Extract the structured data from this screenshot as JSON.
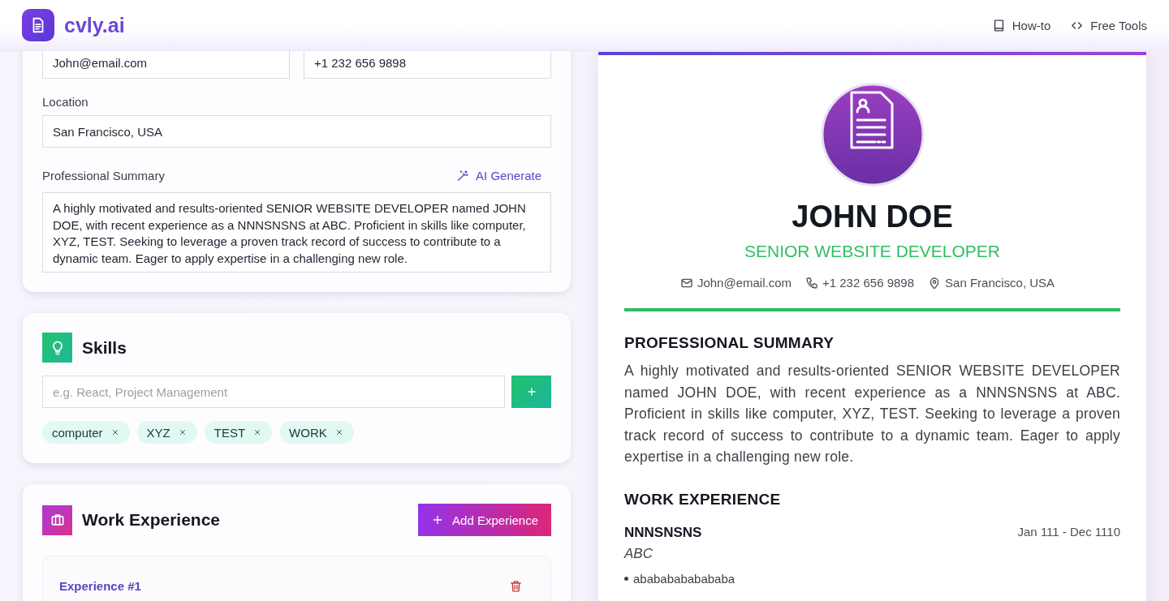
{
  "header": {
    "logo_text": "cvly.ai",
    "nav": [
      {
        "label": "How-to",
        "kind": "book"
      },
      {
        "label": "Free Tools",
        "kind": "code"
      }
    ]
  },
  "editor": {
    "email": "John@email.com",
    "phone": "+1 232 656 9898",
    "location_label": "Location",
    "location": "San Francisco, USA",
    "summary_label": "Professional Summary",
    "ai_button": "AI Generate",
    "summary": "A highly motivated and results-oriented SENIOR WEBSITE DEVELOPER named JOHN DOE, with recent experience as a NNNSNSNS at ABC. Proficient in skills like computer, XYZ, TEST. Seeking to leverage a proven track record of success to contribute to a dynamic team. Eager to apply expertise in a challenging new role."
  },
  "skills": {
    "title": "Skills",
    "placeholder": "e.g. React, Project Management",
    "tags": [
      {
        "label": "computer"
      },
      {
        "label": "XYZ"
      },
      {
        "label": "TEST"
      },
      {
        "label": "WORK"
      }
    ]
  },
  "work": {
    "title": "Work Experience",
    "add_button": "Add Experience",
    "entries": [
      {
        "label": "Experience #1"
      }
    ]
  },
  "preview": {
    "name": "JOHN DOE",
    "title": "SENIOR WEBSITE DEVELOPER",
    "contacts": [
      {
        "kind": "email",
        "text": "John@email.com"
      },
      {
        "kind": "phone",
        "text": "+1 232 656 9898"
      },
      {
        "kind": "location",
        "text": "San Francisco, USA"
      }
    ],
    "summary_heading": "PROFESSIONAL SUMMARY",
    "summary": "A highly motivated and results-oriented SENIOR WEBSITE DEVELOPER named JOHN DOE, with recent experience as a NNNSNSNS at ABC. Proficient in skills like computer, XYZ, TEST. Seeking to leverage a proven track record of success to contribute to a dynamic team. Eager to apply expertise in a challenging new role.",
    "work_heading": "WORK EXPERIENCE",
    "jobs": [
      {
        "role": "NNNSNSNS",
        "dates": "Jan 111 - Dec 1110",
        "company": "ABC",
        "bullets": [
          "abababababababa"
        ]
      }
    ]
  }
}
